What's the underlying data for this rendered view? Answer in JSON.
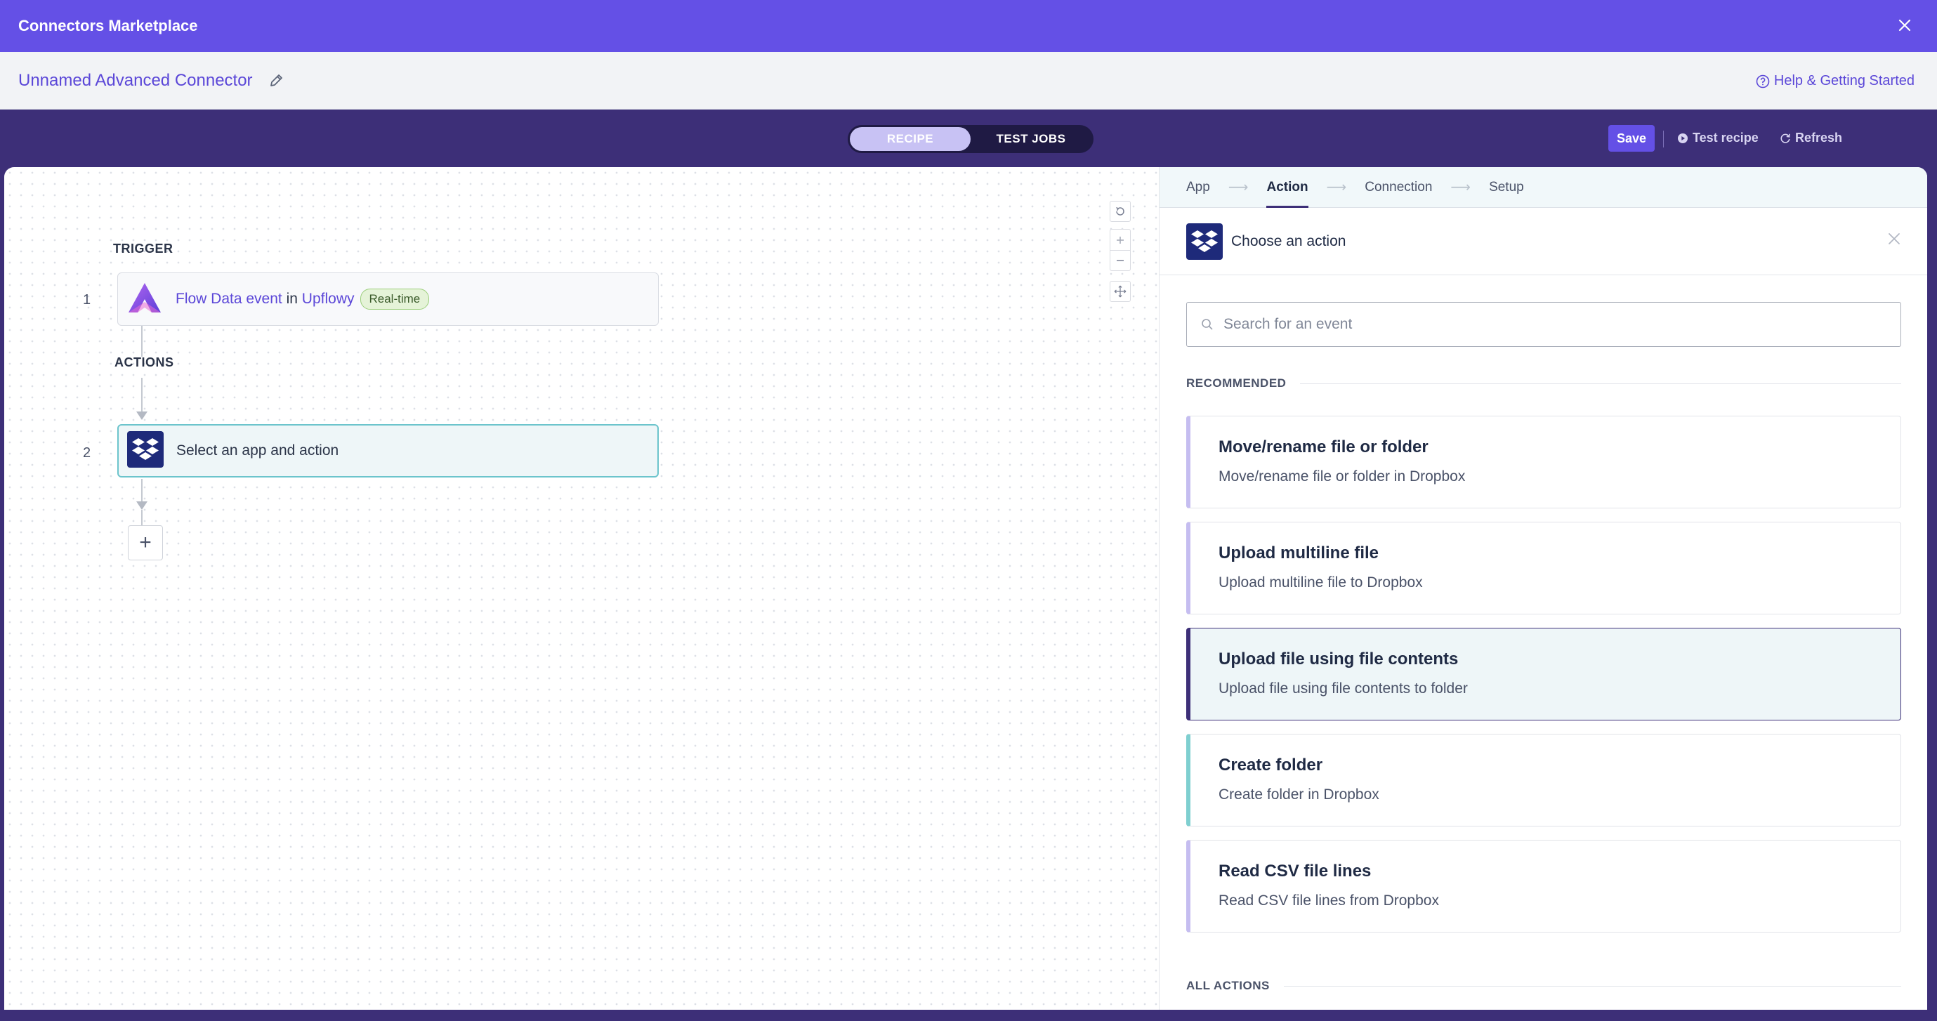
{
  "app": {
    "title": "Connectors Marketplace",
    "connector_name": "Unnamed Advanced Connector",
    "help_label": "Help & Getting Started"
  },
  "toolbar": {
    "tabs": [
      {
        "label": "RECIPE",
        "active": true
      },
      {
        "label": "TEST JOBS",
        "active": false
      }
    ],
    "save_label": "Save",
    "test_recipe_label": "Test recipe",
    "refresh_label": "Refresh"
  },
  "recipe": {
    "trigger_label": "TRIGGER",
    "actions_label": "ACTIONS",
    "steps": [
      {
        "number": "1",
        "event": "Flow Data event",
        "connector": "in",
        "app": "Upflowy",
        "badge": "Real-time",
        "icon": "upflowy-logo-icon"
      },
      {
        "number": "2",
        "text": "Select an app and action",
        "icon": "dropbox-icon"
      }
    ],
    "add_step": "+"
  },
  "wizard": {
    "steps": [
      {
        "label": "App",
        "active": false
      },
      {
        "label": "Action",
        "active": true
      },
      {
        "label": "Connection",
        "active": false
      },
      {
        "label": "Setup",
        "active": false
      }
    ],
    "heading": "Choose an action",
    "search_placeholder": "Search for an event",
    "recommended_label": "RECOMMENDED",
    "all_actions_label": "ALL ACTIONS",
    "actions": [
      {
        "title": "Move/rename file or folder",
        "desc": "Move/rename file or folder in Dropbox",
        "accent": "#c5bdf0",
        "selected": false
      },
      {
        "title": "Upload multiline file",
        "desc": "Upload multiline file to Dropbox",
        "accent": "#c5bdf0",
        "selected": false
      },
      {
        "title": "Upload file using file contents",
        "desc": "Upload file using file contents to folder",
        "accent": "#3d2f78",
        "selected": true
      },
      {
        "title": "Create folder",
        "desc": "Create folder in Dropbox",
        "accent": "#7fcfd0",
        "selected": false
      },
      {
        "title": "Read CSV file lines",
        "desc": "Read CSV file lines from Dropbox",
        "accent": "#c5bdf0",
        "selected": false
      }
    ]
  },
  "colors": {
    "header": "#6450e6",
    "toolbar": "#3d2f78",
    "link": "#5b47d8",
    "dropbox": "#1e2a7a"
  }
}
